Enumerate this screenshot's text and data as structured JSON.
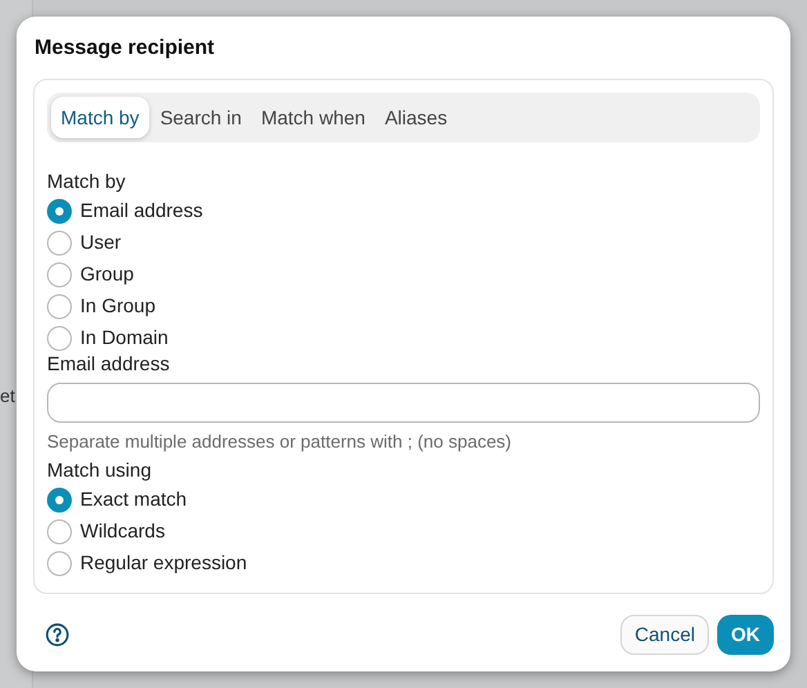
{
  "background": {
    "text": "et"
  },
  "dialog": {
    "title": "Message recipient",
    "tabs": [
      {
        "label": "Match by",
        "selected": true
      },
      {
        "label": "Search in",
        "selected": false
      },
      {
        "label": "Match when",
        "selected": false
      },
      {
        "label": "Aliases",
        "selected": false
      }
    ],
    "match_by": {
      "label": "Match by",
      "options": [
        {
          "label": "Email address",
          "selected": true
        },
        {
          "label": "User",
          "selected": false
        },
        {
          "label": "Group",
          "selected": false
        },
        {
          "label": "In Group",
          "selected": false
        },
        {
          "label": "In Domain",
          "selected": false
        }
      ]
    },
    "email_field": {
      "label": "Email address",
      "hint": "Separate multiple addresses or patterns with ; (no spaces)"
    },
    "match_using": {
      "label": "Match using",
      "options": [
        {
          "label": "Exact match",
          "selected": true
        },
        {
          "label": "Wildcards",
          "selected": false
        },
        {
          "label": "Regular expression",
          "selected": false
        }
      ]
    },
    "buttons": {
      "cancel": "Cancel",
      "ok": "OK"
    }
  }
}
